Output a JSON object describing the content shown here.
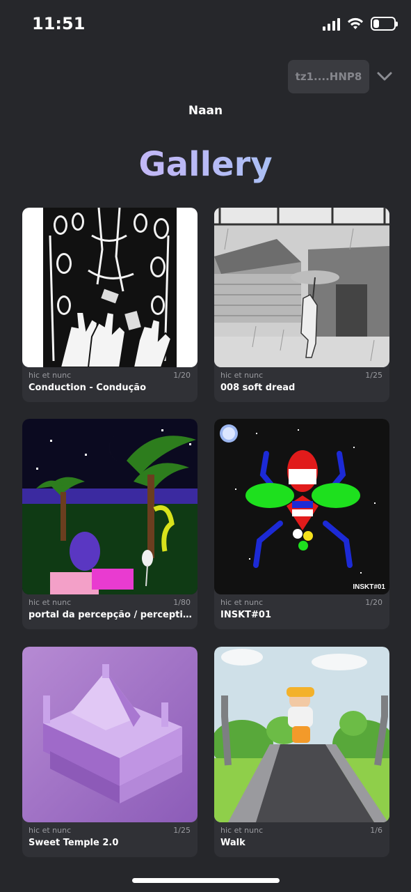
{
  "status": {
    "time": "11:51"
  },
  "header": {
    "wallet": "tz1....HNP8",
    "username": "Naan",
    "title": "Gallery"
  },
  "cards": [
    {
      "platform": "hic et nunc",
      "edition": "1/20",
      "title": "Conduction - Condução"
    },
    {
      "platform": "hic et nunc",
      "edition": "1/25",
      "title": "008 soft dread"
    },
    {
      "platform": "hic et nunc",
      "edition": "1/80",
      "title": "portal da percepção / perception ..."
    },
    {
      "platform": "hic et nunc",
      "edition": "1/20",
      "title": "INSKT#01",
      "overlay": "INSKT#01"
    },
    {
      "platform": "hic et nunc",
      "edition": "1/25",
      "title": "Sweet Temple 2.0"
    },
    {
      "platform": "hic et nunc",
      "edition": "1/6",
      "title": "Walk"
    }
  ]
}
